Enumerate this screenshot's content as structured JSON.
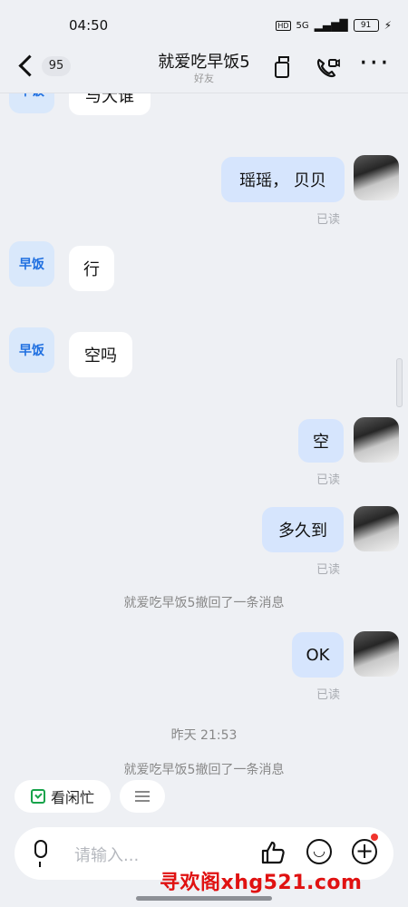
{
  "status_bar": {
    "time": "04:50",
    "network": "5G",
    "battery": "91"
  },
  "header": {
    "unread_count": "95",
    "title": "就爱吃早饭5",
    "subtitle": "好友"
  },
  "chat": {
    "partial_top": "与犬谁",
    "peer_avatar_label": "早饭",
    "messages": [
      {
        "side": "me",
        "text": "瑶瑶， 贝贝",
        "read": "已读"
      },
      {
        "side": "peer",
        "text": "行"
      },
      {
        "side": "peer",
        "text": "空吗"
      },
      {
        "side": "me",
        "text": "空",
        "read": "已读"
      },
      {
        "side": "me",
        "text": "多久到",
        "read": "已读"
      },
      {
        "side": "system",
        "text": "就爱吃早饭5撤回了一条消息"
      },
      {
        "side": "me",
        "text": "OK",
        "read": "已读"
      },
      {
        "side": "time",
        "text": "昨天 21:53"
      },
      {
        "side": "system",
        "text": "就爱吃早饭5撤回了一条消息"
      }
    ]
  },
  "quick_chips": {
    "status_chip": "看闲忙"
  },
  "input_bar": {
    "placeholder": "请输入..."
  },
  "watermark": "寻欢阁xhg521.com",
  "colors": {
    "background": "#eef0f4",
    "my_bubble": "#d6e5fd",
    "peer_bubble": "#ffffff",
    "peer_avatar_bg": "#d9e8fb",
    "peer_avatar_text": "#1f6fe0",
    "watermark": "#e01111",
    "chip_green": "#17a34a",
    "notification_dot": "#f0342d"
  }
}
